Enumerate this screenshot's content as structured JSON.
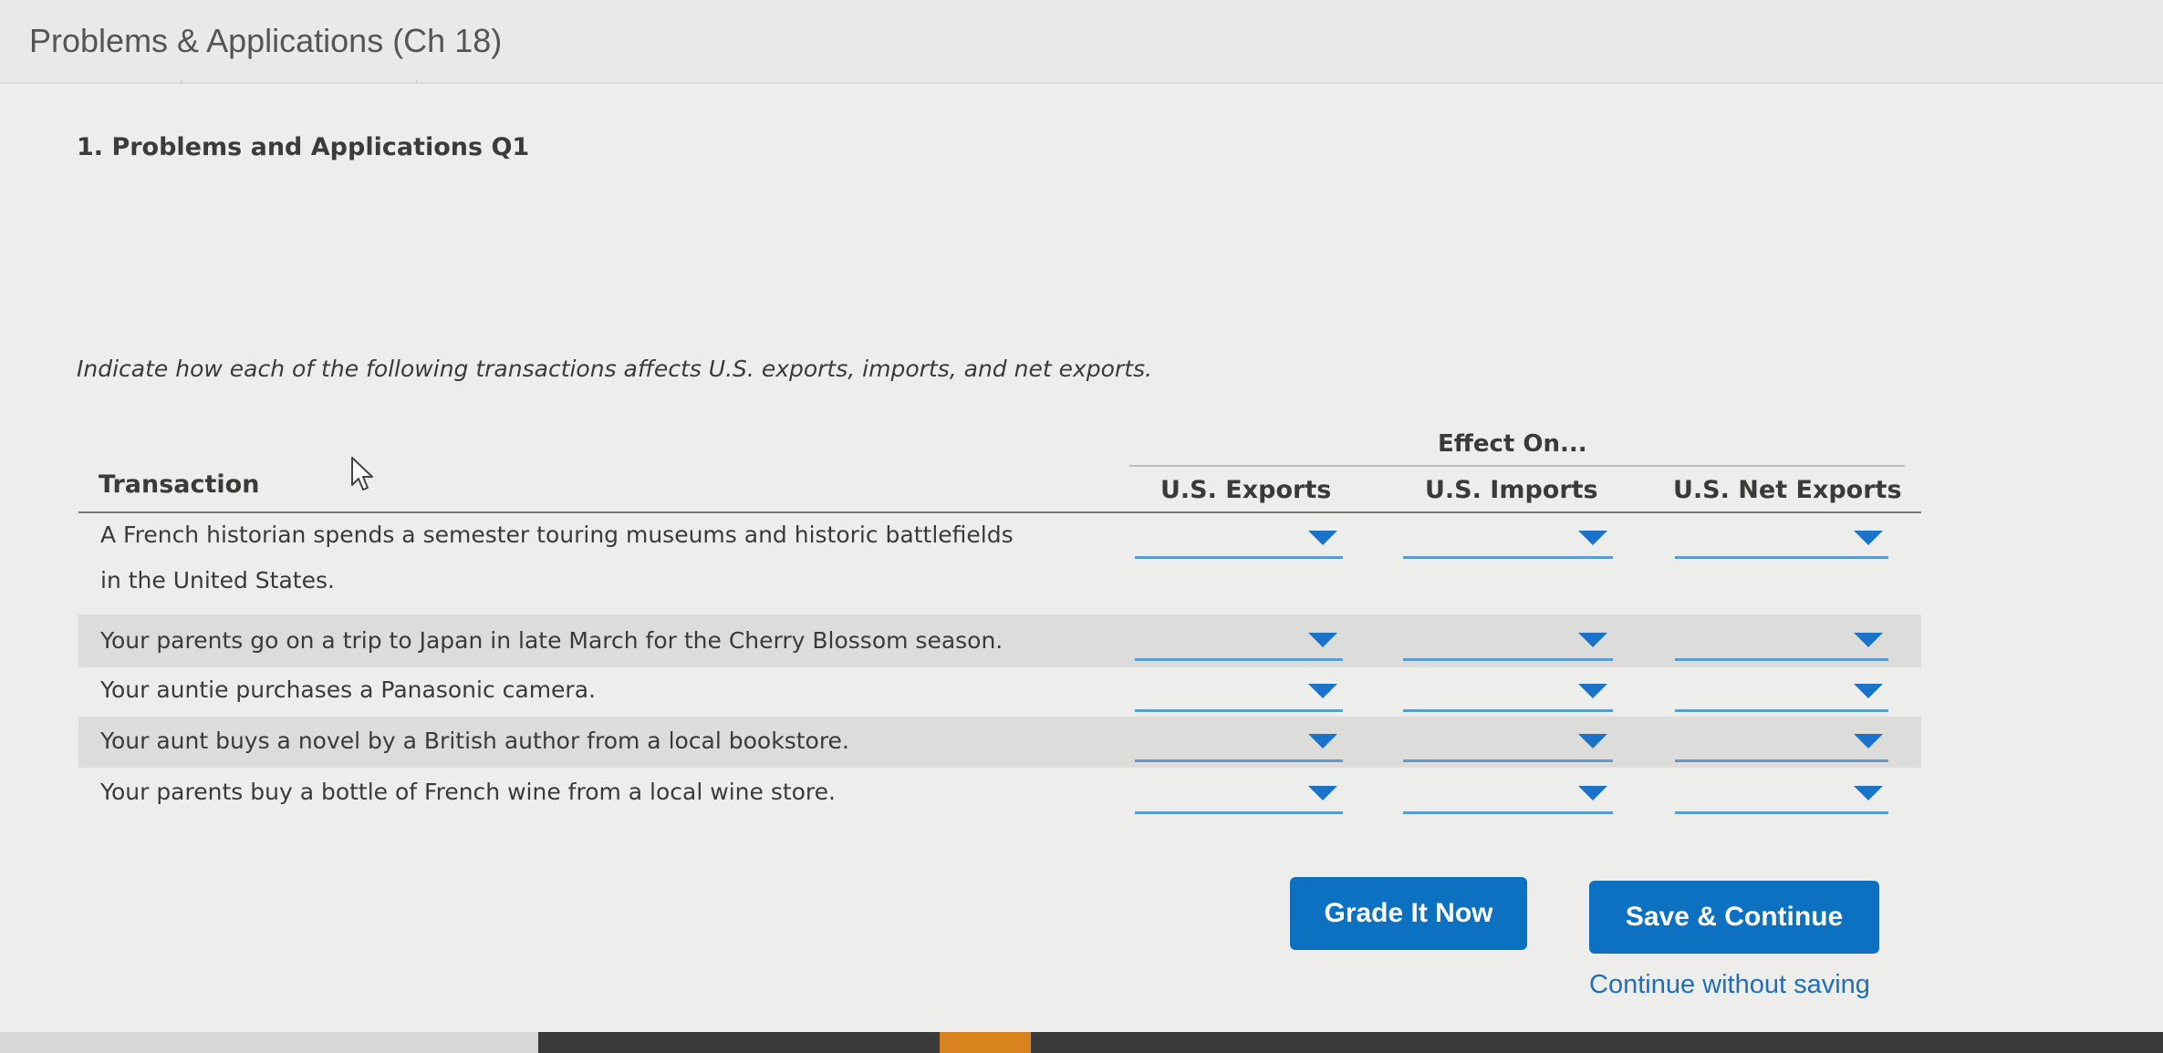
{
  "header": {
    "title": "Problems & Applications (Ch 18)"
  },
  "question": {
    "heading": "1. Problems and Applications Q1",
    "instructions": "Indicate how each of the following transactions affects U.S. exports, imports, and net exports."
  },
  "table": {
    "group_header": "Effect On...",
    "columns": [
      "Transaction",
      "U.S. Exports",
      "U.S. Imports",
      "U.S. Net Exports"
    ],
    "rows": [
      {
        "line1": "A French historian spends a semester touring museums and historic battlefields",
        "line2": "in the United States.",
        "exports": "",
        "imports": "",
        "net_exports": ""
      },
      {
        "line1": "Your parents go on a trip to Japan in late March for the Cherry Blossom season.",
        "exports": "",
        "imports": "",
        "net_exports": ""
      },
      {
        "line1": "Your auntie purchases a Panasonic camera.",
        "exports": "",
        "imports": "",
        "net_exports": ""
      },
      {
        "line1": "Your aunt buys a novel by a British author from a local bookstore.",
        "exports": "",
        "imports": "",
        "net_exports": ""
      },
      {
        "line1": "Your parents buy a bottle of French wine from a local wine store.",
        "exports": "",
        "imports": "",
        "net_exports": ""
      }
    ]
  },
  "buttons": {
    "grade": "Grade It Now",
    "save": "Save & Continue",
    "continue_link": "Continue without saving"
  },
  "colors": {
    "accent": "#0b71c0",
    "dropdown_line": "#5b9bd5",
    "arrow": "#1a73c8"
  }
}
